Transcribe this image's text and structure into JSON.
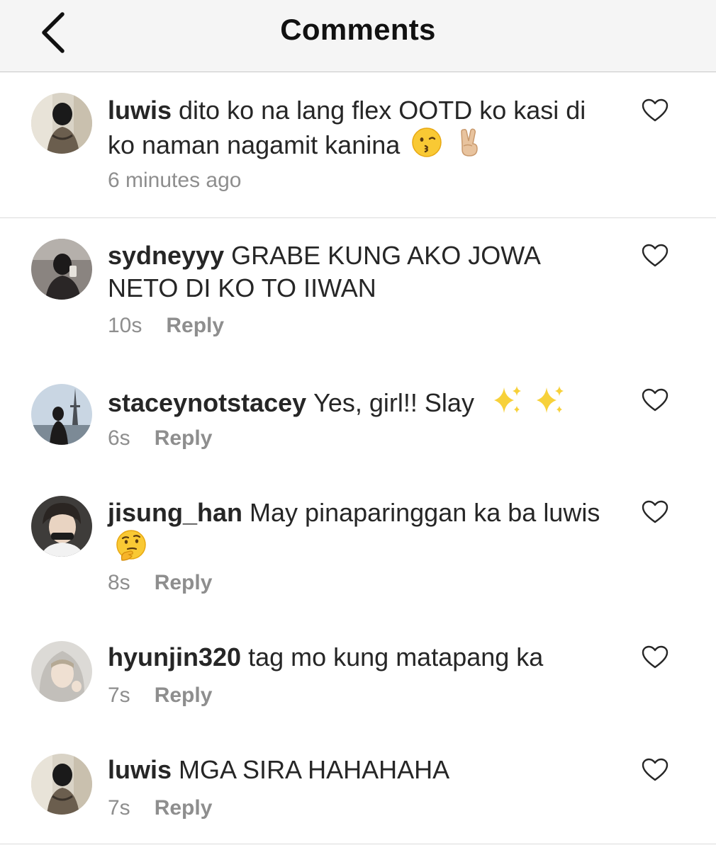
{
  "header": {
    "title": "Comments"
  },
  "comments": [
    {
      "username": "luwis",
      "text": "dito ko na lang flex OOTD ko kasi di ko naman nagamit kanina",
      "emojis": [
        "kissing-face",
        "victory-hand"
      ],
      "time": "6 minutes ago",
      "reply_label": ""
    },
    {
      "username": "sydneyyy",
      "text": "GRABE KUNG AKO JOWA NETO DI KO TO IIWAN",
      "emojis": [],
      "time": "10s",
      "reply_label": "Reply"
    },
    {
      "username": "staceynotstacey",
      "text": "Yes, girl!! Slay",
      "emojis": [
        "sparkles",
        "sparkles"
      ],
      "time": "6s",
      "reply_label": "Reply"
    },
    {
      "username": "jisung_han",
      "text": "May pinaparinggan ka ba luwis",
      "emojis": [
        "thinking-face"
      ],
      "time": "8s",
      "reply_label": "Reply"
    },
    {
      "username": "hyunjin320",
      "text": "tag mo kung matapang ka",
      "emojis": [],
      "time": "7s",
      "reply_label": "Reply"
    },
    {
      "username": "luwis",
      "text": "MGA SIRA HAHAHAHA",
      "emojis": [],
      "time": "7s",
      "reply_label": "Reply"
    }
  ],
  "icons": {
    "back": "chevron-left-icon",
    "like": "heart-outline-icon"
  },
  "colors": {
    "header_bg": "#f5f5f5",
    "text": "#262626",
    "muted": "#8e8e8e",
    "divider": "#dbdbdb"
  }
}
